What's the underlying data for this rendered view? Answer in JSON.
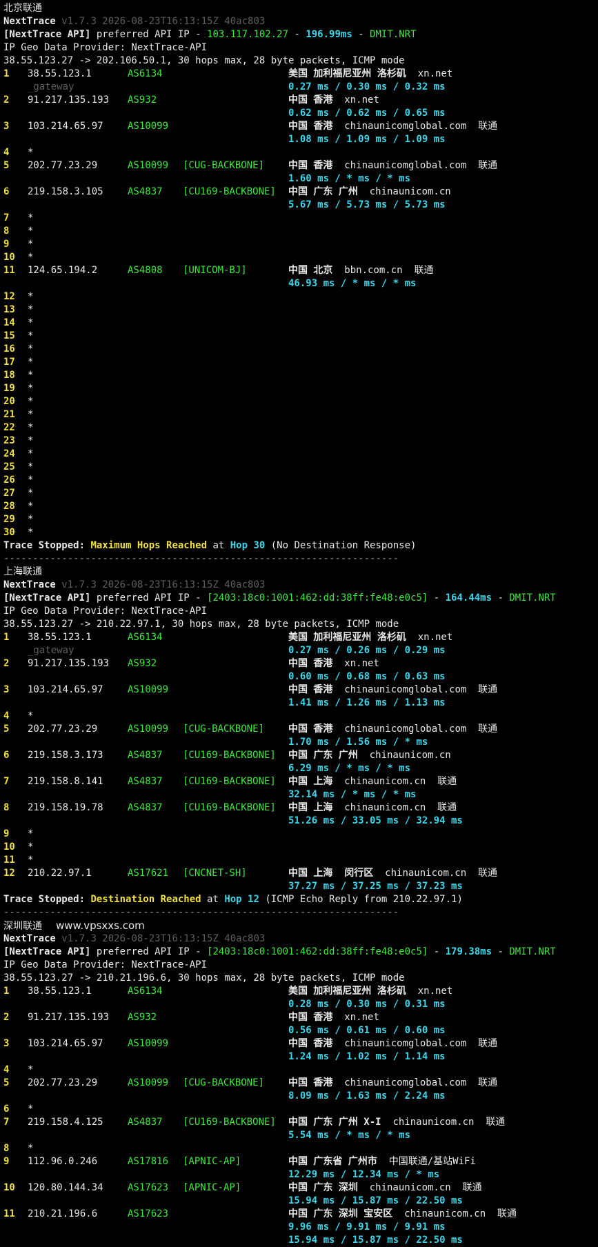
{
  "colors": {
    "background": "#000000",
    "hop_number": "#f0e040",
    "asn": "#3ee83e",
    "latency": "#3cd6ea",
    "dim": "#5e5e5e"
  },
  "sections": [
    {
      "title": "北京联通",
      "brand": "NextTrace",
      "version": "v1.7.3 2026-08-23T16:13:15Z 40ac803",
      "api_prefix": "[NextTrace API]",
      "api_mid": " preferred API IP - ",
      "api_ip": "103.117.102.27",
      "api_latency": "196.99ms",
      "api_dash": " - ",
      "api_node": "DMIT.NRT",
      "provider": "IP Geo Data Provider: NextTrace-API",
      "route": "38.55.123.27 -> 202.106.50.1, 30 hops max, 28 byte packets, ICMP mode",
      "hops": [
        {
          "n": "1",
          "ip": "38.55.123.1",
          "as": "AS6134",
          "tag": "",
          "geo": "美国 加利福尼亚州 洛杉矶",
          "org": "xn.net",
          "isp": "",
          "lat": "0.27 ms / 0.30 ms / 0.32 ms",
          "extra": "_gateway"
        },
        {
          "n": "2",
          "ip": "91.217.135.193",
          "as": "AS932",
          "tag": "",
          "geo": "中国 香港",
          "org": "xn.net",
          "isp": "",
          "lat": "0.62 ms / 0.62 ms / 0.65 ms"
        },
        {
          "n": "3",
          "ip": "103.214.65.97",
          "as": "AS10099",
          "tag": "",
          "geo": "中国 香港",
          "org": "chinaunicomglobal.com",
          "isp": "联通",
          "lat": "1.08 ms / 1.09 ms / 1.09 ms"
        },
        {
          "n": "4",
          "star": "*"
        },
        {
          "n": "5",
          "ip": "202.77.23.29",
          "as": "AS10099",
          "tag": "[CUG-BACKBONE]",
          "geo": "中国 香港",
          "org": "chinaunicomglobal.com",
          "isp": "联通",
          "lat": "1.60 ms / * ms / * ms"
        },
        {
          "n": "6",
          "ip": "219.158.3.105",
          "as": "AS4837",
          "tag": "[CU169-BACKBONE]",
          "geo": "中国 广东 广州",
          "org": "chinaunicom.cn",
          "isp": "",
          "lat": "5.67 ms / 5.73 ms / 5.73 ms"
        },
        {
          "n": "7",
          "star": "*"
        },
        {
          "n": "8",
          "star": "*"
        },
        {
          "n": "9",
          "star": "*"
        },
        {
          "n": "10",
          "star": "*"
        },
        {
          "n": "11",
          "ip": "124.65.194.2",
          "as": "AS4808",
          "tag": "[UNICOM-BJ]",
          "geo": "中国 北京",
          "org": "bbn.com.cn",
          "isp": "联通",
          "lat": "46.93 ms / * ms / * ms"
        },
        {
          "n": "12",
          "star": "*"
        },
        {
          "n": "13",
          "star": "*"
        },
        {
          "n": "14",
          "star": "*"
        },
        {
          "n": "15",
          "star": "*"
        },
        {
          "n": "16",
          "star": "*"
        },
        {
          "n": "17",
          "star": "*"
        },
        {
          "n": "18",
          "star": "*"
        },
        {
          "n": "19",
          "star": "*"
        },
        {
          "n": "20",
          "star": "*"
        },
        {
          "n": "21",
          "star": "*"
        },
        {
          "n": "22",
          "star": "*"
        },
        {
          "n": "23",
          "star": "*"
        },
        {
          "n": "24",
          "star": "*"
        },
        {
          "n": "25",
          "star": "*"
        },
        {
          "n": "26",
          "star": "*"
        },
        {
          "n": "27",
          "star": "*"
        },
        {
          "n": "28",
          "star": "*"
        },
        {
          "n": "29",
          "star": "*"
        },
        {
          "n": "30",
          "star": "*"
        }
      ],
      "stop": {
        "prefix": "Trace Stopped: ",
        "reason": "Maximum Hops Reached",
        "at": " at ",
        "hop": "Hop 30",
        "suffix": " (No Destination Response)"
      },
      "divider": "--------------------------------------------------------------------"
    },
    {
      "title": "上海联通",
      "brand": "NextTrace",
      "version": "v1.7.3 2026-08-23T16:13:15Z 40ac803",
      "api_prefix": "[NextTrace API]",
      "api_mid": " preferred API IP - ",
      "api_ip": "[2403:18c0:1001:462:dd:38ff:fe48:e0c5]",
      "api_latency": "164.44ms",
      "api_dash": " - ",
      "api_node": "DMIT.NRT",
      "provider": "IP Geo Data Provider: NextTrace-API",
      "route": "38.55.123.27 -> 210.22.97.1, 30 hops max, 28 byte packets, ICMP mode",
      "hops": [
        {
          "n": "1",
          "ip": "38.55.123.1",
          "as": "AS6134",
          "tag": "",
          "geo": "美国 加利福尼亚州 洛杉矶",
          "org": "xn.net",
          "isp": "",
          "lat": "0.27 ms / 0.26 ms / 0.29 ms",
          "extra": "_gateway"
        },
        {
          "n": "2",
          "ip": "91.217.135.193",
          "as": "AS932",
          "tag": "",
          "geo": "中国 香港",
          "org": "xn.net",
          "isp": "",
          "lat": "0.60 ms / 0.68 ms / 0.63 ms"
        },
        {
          "n": "3",
          "ip": "103.214.65.97",
          "as": "AS10099",
          "tag": "",
          "geo": "中国 香港",
          "org": "chinaunicomglobal.com",
          "isp": "联通",
          "lat": "1.41 ms / 1.26 ms / 1.13 ms"
        },
        {
          "n": "4",
          "star": "*"
        },
        {
          "n": "5",
          "ip": "202.77.23.29",
          "as": "AS10099",
          "tag": "[CUG-BACKBONE]",
          "geo": "中国 香港",
          "org": "chinaunicomglobal.com",
          "isp": "联通",
          "lat": "1.70 ms / 1.56 ms / * ms"
        },
        {
          "n": "6",
          "ip": "219.158.3.173",
          "as": "AS4837",
          "tag": "[CU169-BACKBONE]",
          "geo": "中国 广东 广州",
          "org": "chinaunicom.cn",
          "isp": "",
          "lat": "6.29 ms / * ms / * ms"
        },
        {
          "n": "7",
          "ip": "219.158.8.141",
          "as": "AS4837",
          "tag": "[CU169-BACKBONE]",
          "geo": "中国 上海",
          "org": "chinaunicom.cn",
          "isp": "联通",
          "lat": "32.14 ms / * ms / * ms"
        },
        {
          "n": "8",
          "ip": "219.158.19.78",
          "as": "AS4837",
          "tag": "[CU169-BACKBONE]",
          "geo": "中国 上海",
          "org": "chinaunicom.cn",
          "isp": "联通",
          "lat": "51.26 ms / 33.05 ms / 32.94 ms"
        },
        {
          "n": "9",
          "star": "*"
        },
        {
          "n": "10",
          "star": "*"
        },
        {
          "n": "11",
          "star": "*"
        },
        {
          "n": "12",
          "ip": "210.22.97.1",
          "as": "AS17621",
          "tag": "[CNCNET-SH]",
          "geo": "中国 上海  闵行区",
          "org": "chinaunicom.cn",
          "isp": "联通",
          "lat": "37.27 ms / 37.25 ms / 37.23 ms"
        }
      ],
      "stop": {
        "prefix": "Trace Stopped: ",
        "reason": "Destination Reached",
        "at": " at ",
        "hop": "Hop 12",
        "suffix": " (ICMP Echo Reply from 210.22.97.1)"
      },
      "divider": "--------------------------------------------------------------------"
    },
    {
      "title": "深圳联通",
      "watermark": "www.vpsxxs.com",
      "brand": "NextTrace",
      "version": "v1.7.3 2026-08-23T16:13:15Z 40ac803",
      "api_prefix": "[NextTrace API]",
      "api_mid": " preferred API IP - ",
      "api_ip": "[2403:18c0:1001:462:dd:38ff:fe48:e0c5]",
      "api_latency": "179.38ms",
      "api_dash": " - ",
      "api_node": "DMIT.NRT",
      "provider": "IP Geo Data Provider: NextTrace-API",
      "route": "38.55.123.27 -> 210.21.196.6, 30 hops max, 28 byte packets, ICMP mode",
      "hops": [
        {
          "n": "1",
          "ip": "38.55.123.1",
          "as": "AS6134",
          "tag": "",
          "geo": "美国 加利福尼亚州 洛杉矶",
          "org": "xn.net",
          "isp": "",
          "lat": "0.28 ms / 0.30 ms / 0.31 ms"
        },
        {
          "n": "2",
          "ip": "91.217.135.193",
          "as": "AS932",
          "tag": "",
          "geo": "中国 香港",
          "org": "xn.net",
          "isp": "",
          "lat": "0.56 ms / 0.61 ms / 0.60 ms"
        },
        {
          "n": "3",
          "ip": "103.214.65.97",
          "as": "AS10099",
          "tag": "",
          "geo": "中国 香港",
          "org": "chinaunicomglobal.com",
          "isp": "联通",
          "lat": "1.24 ms / 1.02 ms / 1.14 ms"
        },
        {
          "n": "4",
          "star": "*"
        },
        {
          "n": "5",
          "ip": "202.77.23.29",
          "as": "AS10099",
          "tag": "[CUG-BACKBONE]",
          "geo": "中国 香港",
          "org": "chinaunicomglobal.com",
          "isp": "联通",
          "lat": "8.09 ms / 1.63 ms / 2.24 ms"
        },
        {
          "n": "6",
          "star": "*"
        },
        {
          "n": "7",
          "ip": "219.158.4.125",
          "as": "AS4837",
          "tag": "[CU169-BACKBONE]",
          "geo": "中国 广东 广州 X-I",
          "org": "chinaunicom.cn",
          "isp": "联通",
          "lat": "5.54 ms / * ms / * ms"
        },
        {
          "n": "8",
          "star": "*"
        },
        {
          "n": "9",
          "ip": "112.96.0.246",
          "as": "AS17816",
          "tag": "[APNIC-AP]",
          "geo": "中国 广东省 广州市",
          "org": "中国联通/基站WiFi",
          "isp": "",
          "lat": "12.29 ms / 12.34 ms / * ms"
        },
        {
          "n": "10",
          "ip": "120.80.144.34",
          "as": "AS17623",
          "tag": "[APNIC-AP]",
          "geo": "中国 广东 深圳",
          "org": "chinaunicom.cn",
          "isp": "联通",
          "lat": "15.94 ms / 15.87 ms / 22.50 ms"
        },
        {
          "n": "11",
          "ip": "210.21.196.6",
          "as": "AS17623",
          "tag": "",
          "geo": "中国 广东 深圳 宝安区",
          "org": "chinaunicom.cn",
          "isp": "联通",
          "lat": "9.96 ms / 9.91 ms / 9.91 ms",
          "lat2": "15.94 ms / 15.87 ms / 22.50 ms"
        }
      ]
    }
  ]
}
